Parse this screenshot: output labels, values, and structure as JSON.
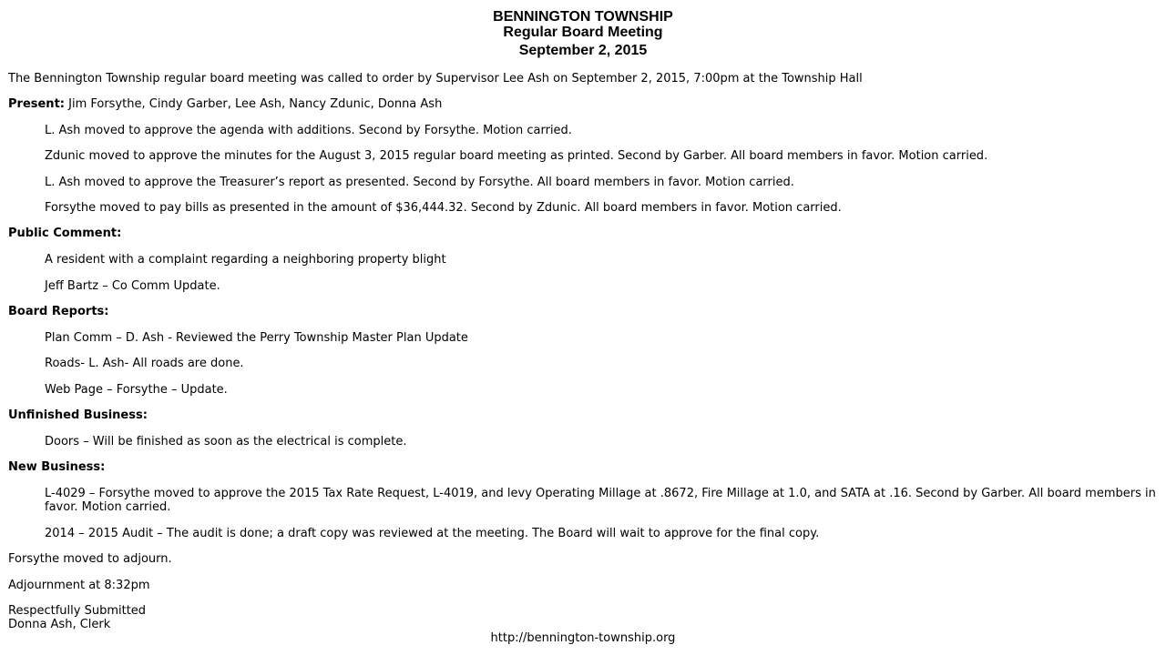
{
  "header": {
    "township": "BENNINGTON TOWNSHIP",
    "meeting": "Regular Board Meeting",
    "date": "September 2, 2015"
  },
  "intro": "The Bennington Township regular board meeting was called to order by Supervisor Lee Ash on September 2, 2015, 7:00pm at the Township Hall",
  "present": {
    "label": "Present:",
    "names": " Jim Forsythe, Cindy Garber, Lee Ash, Nancy Zdunic, Donna Ash"
  },
  "motions": [
    "L. Ash moved to approve the agenda with additions. Second by Forsythe. Motion carried.",
    "Zdunic moved to approve the minutes for the August 3, 2015 regular board meeting as printed. Second by Garber. All board members in favor. Motion carried.",
    "L. Ash moved to approve the Treasurer’s report as presented. Second by Forsythe. All board members in favor. Motion carried.",
    "Forsythe moved to pay bills as presented in the amount of $36,444.32. Second by Zdunic. All board members in favor. Motion carried."
  ],
  "public_comment": {
    "label": "Public Comment:",
    "items": [
      "A resident with a complaint regarding a neighboring property blight",
      "Jeff Bartz – Co Comm Update."
    ]
  },
  "board_reports": {
    "label": "Board Reports:",
    "items": [
      "Plan Comm – D. Ash - Reviewed the Perry Township Master Plan Update",
      "Roads- L. Ash- All roads are done.",
      "Web Page – Forsythe – Update."
    ]
  },
  "unfinished_business": {
    "label": "Unfinished Business:",
    "items": [
      "Doors – Will be finished as soon as the electrical is complete."
    ]
  },
  "new_business": {
    "label": "New Business:",
    "items": [
      "L-4029 – Forsythe moved to approve the 2015 Tax Rate Request, L-4019, and levy Operating Millage at .8672, Fire Millage at 1.0, and SATA at .16. Second by Garber. All board members in favor. Motion carried.",
      "2014 – 2015 Audit – The audit is done; a draft copy was reviewed at the meeting. The Board will wait to approve for the final copy."
    ]
  },
  "closing": {
    "adjourn_motion": "Forsythe moved to adjourn.",
    "adjournment": "Adjournment at 8:32pm",
    "signoff_line1": "Respectfully Submitted",
    "signoff_line2": "Donna Ash, Clerk"
  },
  "footer": {
    "url": "http://bennington-township.org"
  }
}
